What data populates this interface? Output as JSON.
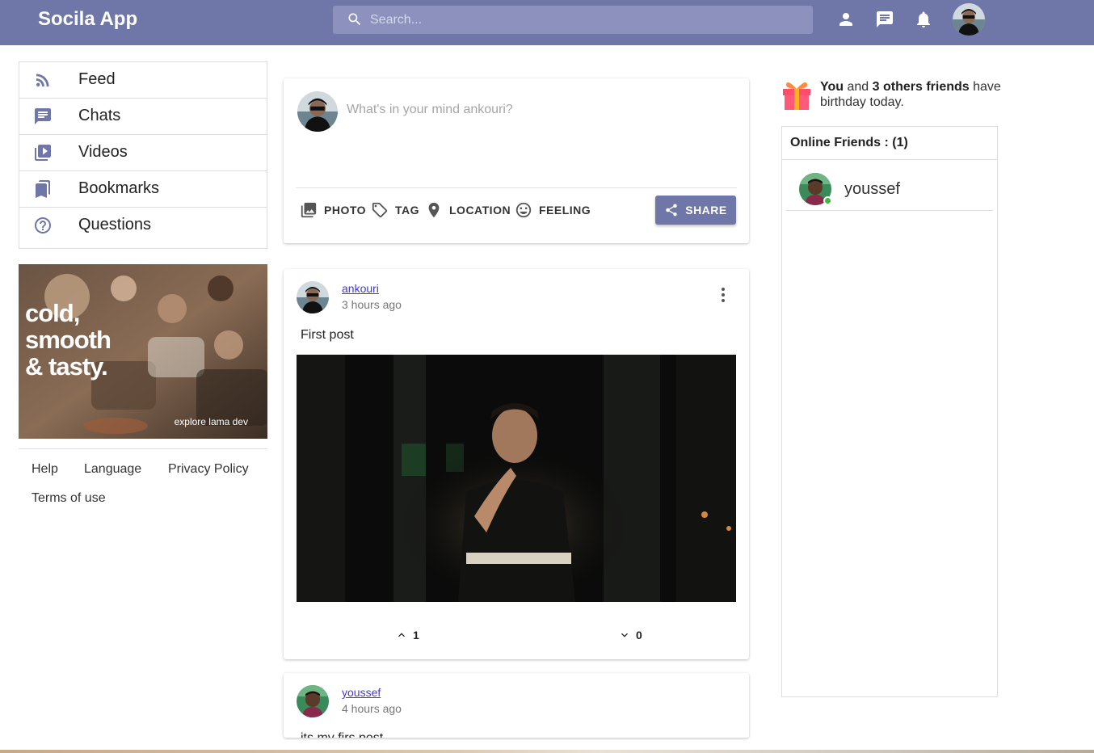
{
  "app": {
    "title": "Socila App"
  },
  "search": {
    "placeholder": "Search..."
  },
  "topbar": {
    "icons": [
      "person-icon",
      "chat-icon",
      "notifications-icon"
    ]
  },
  "sidebar": {
    "items": [
      {
        "label": "Feed",
        "icon": "rss-feed-icon"
      },
      {
        "label": "Chats",
        "icon": "chat-icon"
      },
      {
        "label": "Videos",
        "icon": "video-library-icon"
      },
      {
        "label": "Bookmarks",
        "icon": "bookmark-icon"
      },
      {
        "label": "Questions",
        "icon": "help-outline-icon"
      }
    ],
    "ad": {
      "headline_1": "cold,",
      "headline_2": "smooth",
      "headline_3": "& tasty.",
      "sub": "explore lama dev"
    },
    "footer_links": [
      "Help",
      "Language",
      "Privacy Policy",
      "Terms of use"
    ]
  },
  "composer": {
    "placeholder": "What's in your mind ankouri?",
    "options": [
      "PHOTO",
      "TAG",
      "LOCATION",
      "FEELING"
    ],
    "share_label": "SHARE"
  },
  "posts": [
    {
      "author": "ankouri",
      "time": "3 hours ago",
      "text": "First post",
      "upvotes": "1",
      "downvotes": "0"
    },
    {
      "author": "youssef",
      "time": "4 hours ago",
      "text": "its my firs post"
    }
  ],
  "rightbar": {
    "birthday": {
      "you": "You",
      "and": " and ",
      "others": "3 others friends",
      "rest": " have birthday today."
    },
    "online_title": "Online Friends : (1)",
    "friends": [
      {
        "name": "youssef"
      }
    ]
  },
  "colors": {
    "primary": "#6f76a8",
    "online": "#3cba3c",
    "link": "#4338ca"
  }
}
